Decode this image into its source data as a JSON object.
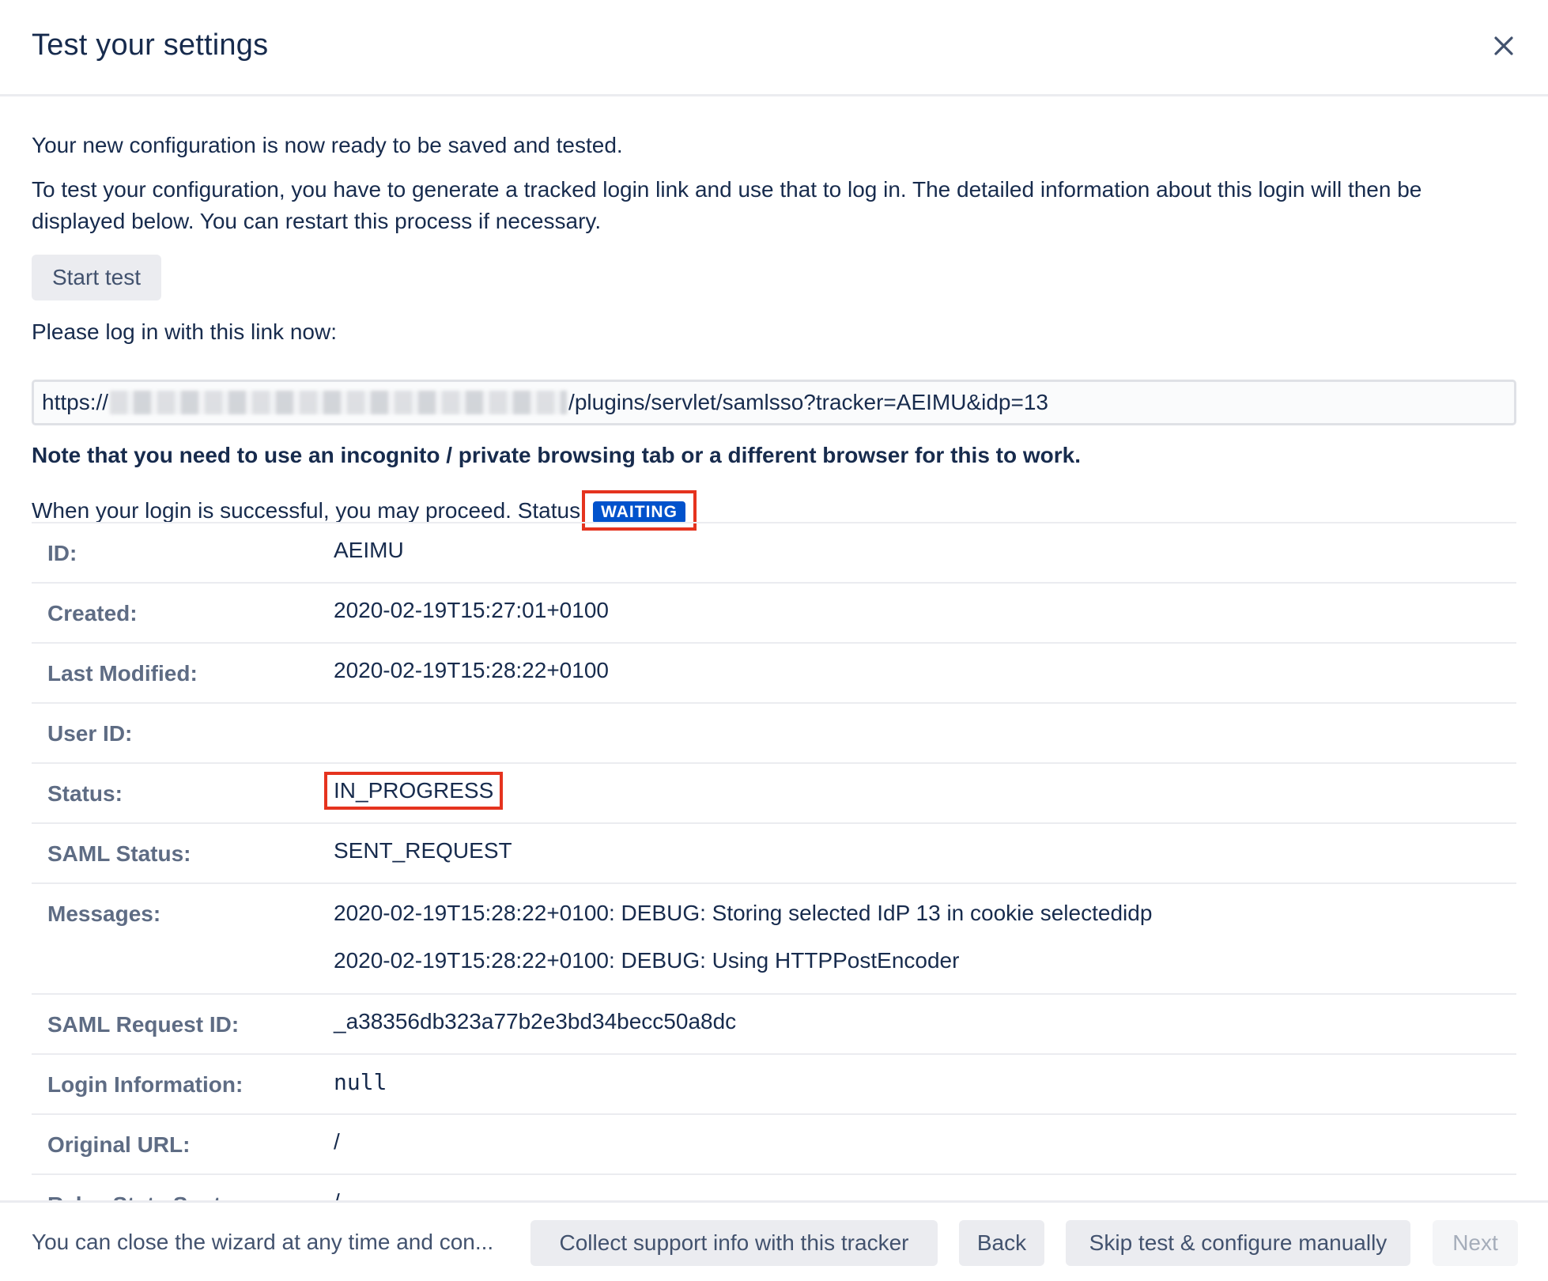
{
  "dialog": {
    "title": "Test your settings",
    "close_icon": "close-icon"
  },
  "intro": {
    "ready_text": "Your new configuration is now ready to be saved and tested.",
    "instructions": "To test your configuration, you have to generate a tracked login link and use that to log in. The detailed information about this login will then be displayed below. You can restart this process if necessary.",
    "start_button": "Start test",
    "link_prompt": "Please log in with this link now:",
    "link_prefix": "https://",
    "link_suffix": "/plugins/servlet/samlsso?tracker=AEIMU&idp=13",
    "note": "Note that you need to use an incognito / private browsing tab or a different browser for this to work.",
    "status_text": "When your login is successful, you may proceed. Status",
    "status_badge": "WAITING",
    "badge_color": "#0052cc",
    "highlight_color": "#e5331e"
  },
  "details": {
    "id_label": "ID:",
    "id_value": "AEIMU",
    "created_label": "Created:",
    "created_value": "2020-02-19T15:27:01+0100",
    "modified_label": "Last Modified:",
    "modified_value": "2020-02-19T15:28:22+0100",
    "user_label": "User ID:",
    "user_value": "",
    "status_label": "Status:",
    "status_value": "IN_PROGRESS",
    "saml_status_label": "SAML Status:",
    "saml_status_value": "SENT_REQUEST",
    "messages_label": "Messages:",
    "messages": [
      "2020-02-19T15:28:22+0100: DEBUG: Storing selected IdP 13 in cookie selectedidp",
      "2020-02-19T15:28:22+0100: DEBUG: Using HTTPPostEncoder"
    ],
    "request_id_label": "SAML Request ID:",
    "request_id_value": "_a38356db323a77b2e3bd34becc50a8dc",
    "login_info_label": "Login Information:",
    "login_info_value": "null",
    "original_url_label": "Original URL:",
    "original_url_value": "/",
    "relay_label": "Relay State Sent:",
    "relay_value": "/"
  },
  "footer": {
    "hint": "You can close the wizard at any time and con...",
    "collect_button": "Collect support info with this tracker",
    "back_button": "Back",
    "skip_button": "Skip test & configure manually",
    "next_button": "Next"
  }
}
